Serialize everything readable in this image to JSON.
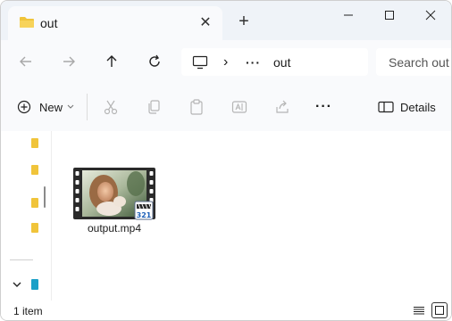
{
  "tab": {
    "title": "out",
    "close_symbol": "✕"
  },
  "new_tab_symbol": "+",
  "address": {
    "chevron": "›",
    "ellipsis": "···",
    "current_folder": "out"
  },
  "search": {
    "placeholder": "Search out"
  },
  "commands": {
    "new_label": "New",
    "more": "···",
    "details_label": "Details"
  },
  "file": {
    "name": "output.mp4",
    "badge": "321"
  },
  "status": {
    "item_count": "1 item"
  },
  "colors": {
    "folder": "#f0c43a",
    "tab_bg": "#f9fafc",
    "titlebar_bg": "#eff3f8",
    "accent": "#1aa0c8"
  }
}
